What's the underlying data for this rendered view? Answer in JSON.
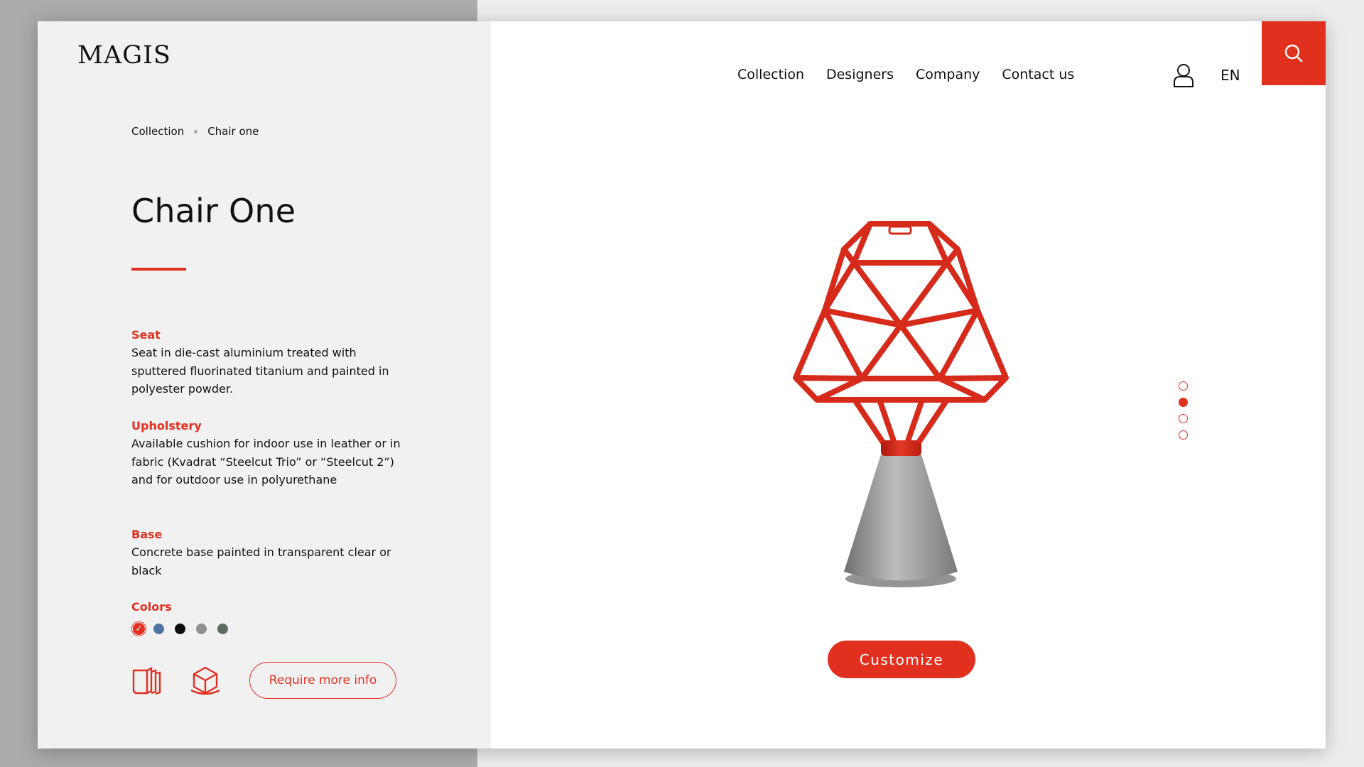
{
  "brand": {
    "logo_text": "MAGIS",
    "accent_color": "#e2301f",
    "panel_color": "#f1f1f1"
  },
  "header": {
    "nav": [
      "Collection",
      "Designers",
      "Company",
      "Contact us"
    ],
    "user_icon": "user-icon",
    "language": "EN",
    "search_icon": "search-icon"
  },
  "breadcrumb": {
    "items": [
      "Collection",
      "Chair one"
    ]
  },
  "product": {
    "title": "Chair One",
    "specs": [
      {
        "label": "Seat",
        "text": "Seat in die-cast aluminium treated with sputtered fluorinated titanium and painted in polyester powder."
      },
      {
        "label": "Upholstery",
        "text": "Available cushion for indoor use in leather or in fabric (Kvadrat “Steelcut Trio” or “Steelcut 2”)  and for outdoor use in polyurethane"
      },
      {
        "label": "Base",
        "text": "Concrete base painted in transparent clear or black"
      }
    ],
    "colors_label": "Colors",
    "colors": [
      {
        "hex": "#e2301f",
        "selected": true
      },
      {
        "hex": "#4f76a3",
        "selected": false
      },
      {
        "hex": "#0d0d0d",
        "selected": false
      },
      {
        "hex": "#909090",
        "selected": false
      },
      {
        "hex": "#5c6b60",
        "selected": false
      }
    ],
    "action_icons": [
      "catalog-icon",
      "3d-cube-icon"
    ],
    "more_info_label": "Require more info",
    "customize_label": "Customize"
  },
  "gallery": {
    "total_slides": 4,
    "active_slide": 2
  }
}
